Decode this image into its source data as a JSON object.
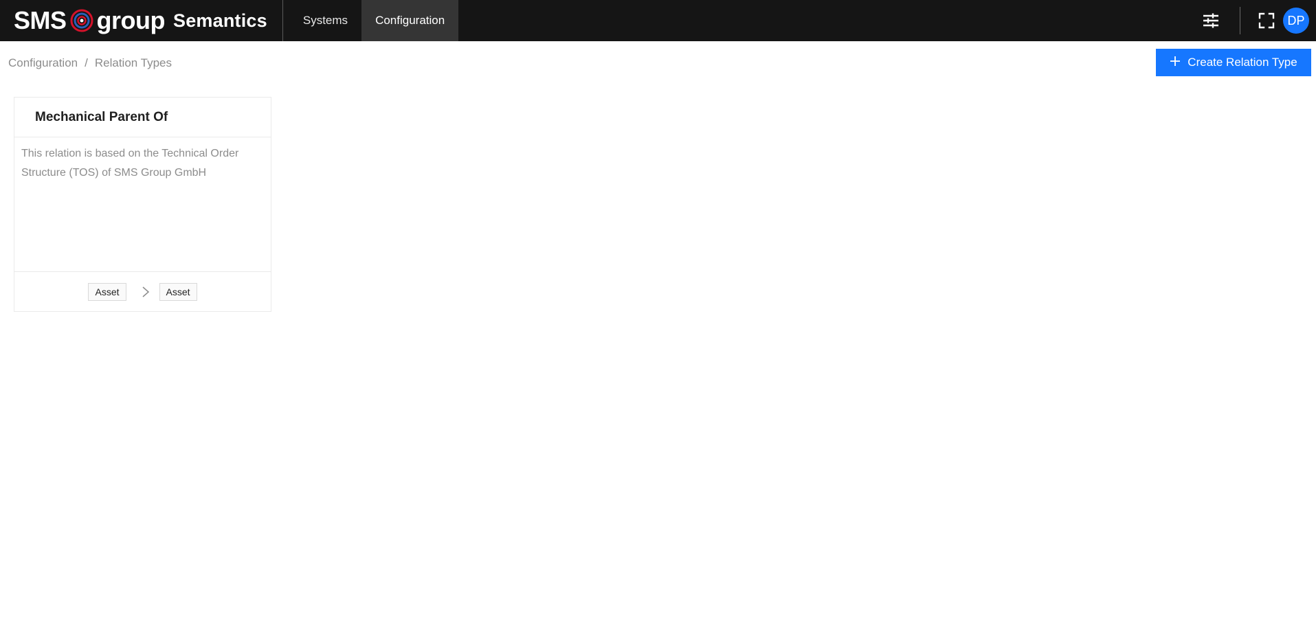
{
  "header": {
    "logo_left": "SMS",
    "logo_right": "group",
    "app_title": "Semantics",
    "nav": [
      {
        "label": "Systems",
        "active": false
      },
      {
        "label": "Configuration",
        "active": true
      }
    ],
    "icons": [
      "sliders-icon",
      "fullscreen-icon"
    ],
    "avatar_initials": "DP",
    "avatar_color": "#1677ff"
  },
  "breadcrumb": {
    "items": [
      "Configuration",
      "Relation Types"
    ],
    "separator": "/"
  },
  "actions": {
    "create_label": "Create Relation Type",
    "create_icon": "plus-icon",
    "accent_color": "#1677ff"
  },
  "cards": [
    {
      "title": "Mechanical Parent Of",
      "description": "This relation is based on the Technical Order Structure (TOS) of SMS Group GmbH",
      "source": "Asset",
      "target": "Asset",
      "arrow_icon": "chevron-right-icon"
    }
  ]
}
